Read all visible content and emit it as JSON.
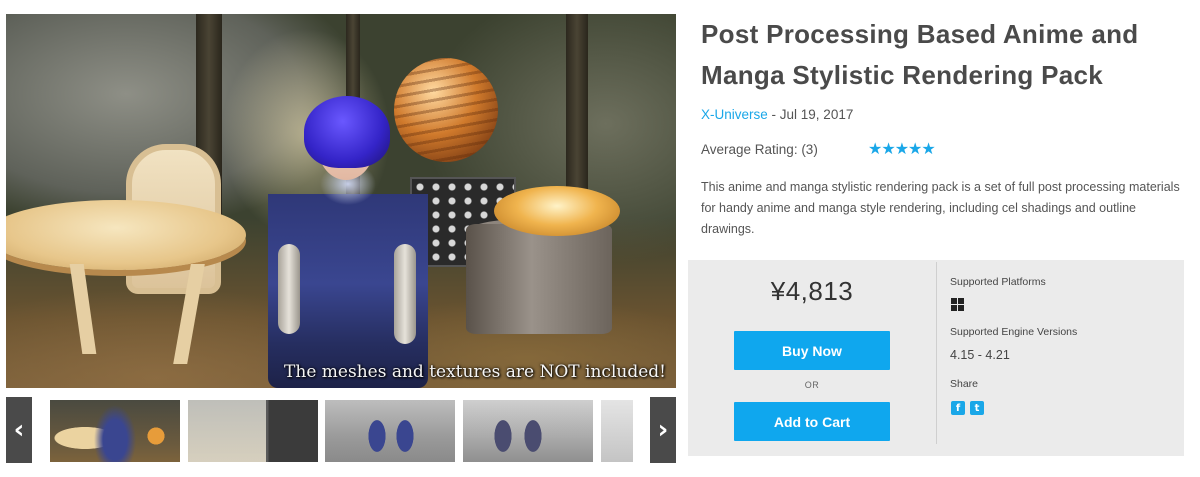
{
  "gallery": {
    "watermark": "The meshes and textures are NOT included!",
    "prev_arrow": "‹",
    "next_arrow": "›",
    "thumbnail_count": 5
  },
  "product": {
    "title": "Post Processing Based Anime and Manga Stylistic Rendering Pack",
    "author": "X-Universe",
    "date_separator": " - ",
    "date": "Jul 19, 2017",
    "rating_label": "Average Rating: (3)",
    "stars": "★★★★★",
    "rating_value": 5,
    "description": "This anime and manga stylistic rendering pack is a set of full post processing materials for handy anime and manga style rendering, including cel shadings and outline drawings."
  },
  "purchase": {
    "price": "¥4,813",
    "buy_now_label": "Buy Now",
    "or_label": "OR",
    "add_to_cart_label": "Add to Cart"
  },
  "sidebar": {
    "platforms_label": "Supported Platforms",
    "platform_icon": "windows-icon",
    "engine_versions_label": "Supported Engine Versions",
    "engine_versions": "4.15 - 4.21",
    "share_label": "Share",
    "share_facebook": "f",
    "share_twitter": "t"
  },
  "colors": {
    "accent": "#0fa7ee",
    "link": "#1aa7e8",
    "panel_bg": "#ebebeb",
    "arrow_bg": "#4a4a4a"
  }
}
